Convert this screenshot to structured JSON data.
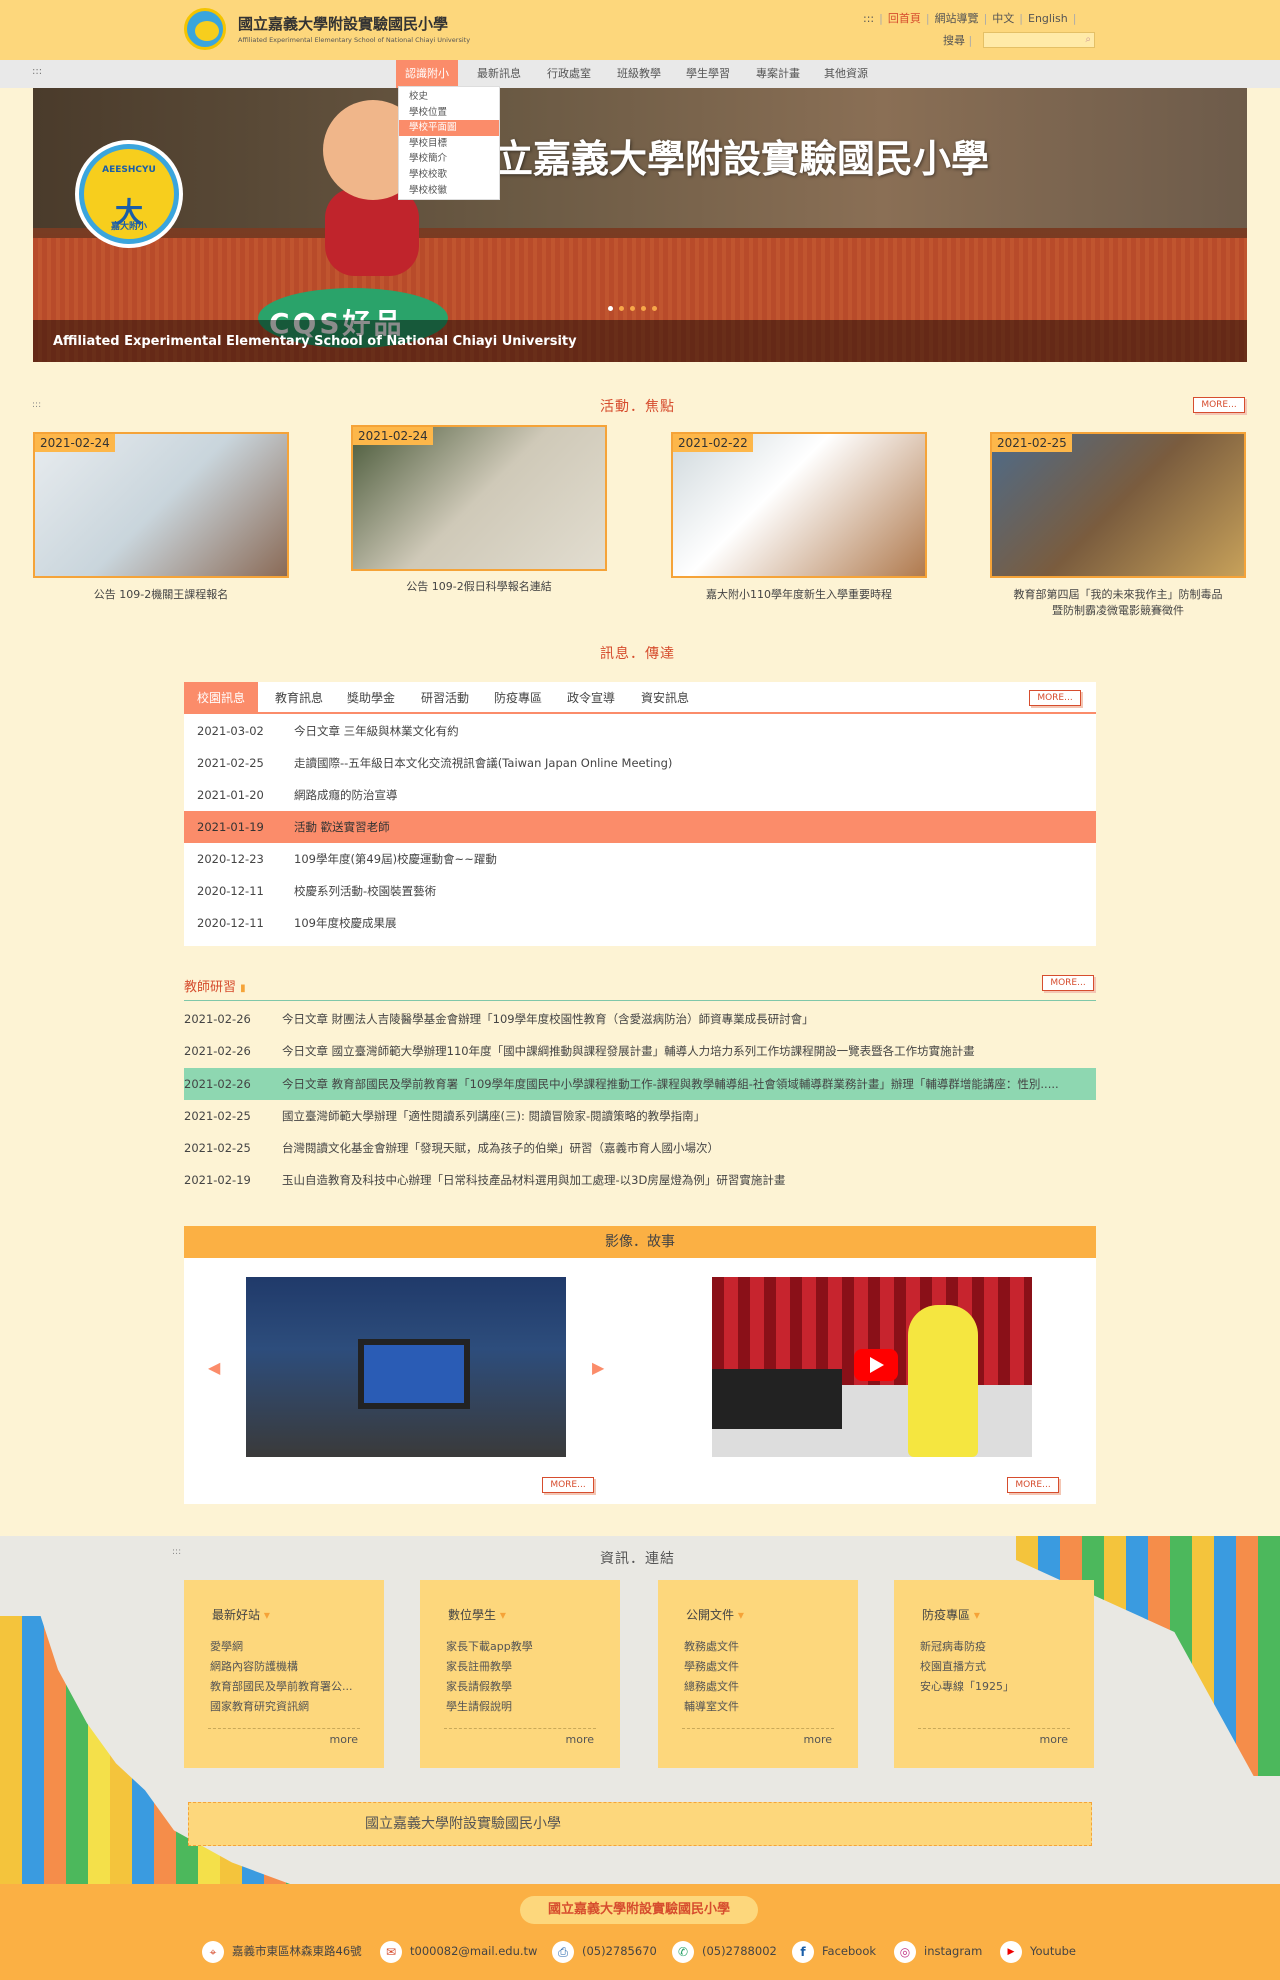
{
  "header": {
    "title": "國立嘉義大學附設實驗國民小學",
    "subtitle": "Affiliated Experimental Elementary School of National Chiayi University",
    "top_links": [
      ":::",
      "回首頁",
      "網站導覽",
      "中文",
      "English"
    ],
    "search_label": "搜尋"
  },
  "nav": {
    "dots": ":::",
    "items": [
      "認識附小",
      "最新訊息",
      "行政處室",
      "班級教學",
      "學生學習",
      "專案計畫",
      "其他資源"
    ],
    "dropdown": [
      "校史",
      "學校位置",
      "學校平面圖",
      "學校目標",
      "學校簡介",
      "學校校歌",
      "學校校徽"
    ]
  },
  "banner": {
    "title": "立嘉義大學附設實驗國民小學",
    "caption": "Affiliated Experimental Elementary School of National Chiayi University",
    "badge_top": "AEESHCYU",
    "badge_mid": "大",
    "badge_bot": "嘉大附小",
    "mascot_base": "CQS好品",
    "slide_active": 1,
    "slide_count": 5
  },
  "focus": {
    "title": "活動．焦點",
    "dots": ":::",
    "more": "MORE...",
    "items": [
      {
        "date": "2021-02-24",
        "caption": "公告 109-2機關王課程報名"
      },
      {
        "date": "2021-02-24",
        "caption": "公告 109-2假日科學報名連結"
      },
      {
        "date": "2021-02-22",
        "caption": "嘉大附小110學年度新生入學重要時程"
      },
      {
        "date": "2021-02-25",
        "caption": "教育部第四屆「我的未來我作主」防制毒品暨防制霸凌微電影競賽徵件"
      }
    ]
  },
  "news": {
    "title": "訊息．傳達",
    "more": "MORE...",
    "tabs": [
      "校園訊息",
      "教育訊息",
      "獎助學金",
      "研習活動",
      "防疫專區",
      "政令宣導",
      "資安訊息"
    ],
    "rows": [
      {
        "date": "2021-03-02",
        "text": "今日文章 三年級與林業文化有約"
      },
      {
        "date": "2021-02-25",
        "text": "走讀國際--五年級日本文化交流視訊會議(Taiwan Japan Online Meeting)"
      },
      {
        "date": "2021-01-20",
        "text": "網路成癮的防治宣導"
      },
      {
        "date": "2021-01-19",
        "text": "活動 歡送實習老師"
      },
      {
        "date": "2020-12-23",
        "text": "109學年度(第49屆)校慶運動會~~躍動"
      },
      {
        "date": "2020-12-11",
        "text": "校慶系列活動-校園裝置藝術"
      },
      {
        "date": "2020-12-11",
        "text": "109年度校慶成果展"
      }
    ]
  },
  "teacher": {
    "title": "教師研習",
    "more": "MORE...",
    "rows": [
      {
        "date": "2021-02-26",
        "text": "今日文章 財團法人吉陵醫學基金會辦理「109學年度校園性教育（含愛滋病防治）師資專業成長研討會」"
      },
      {
        "date": "2021-02-26",
        "text": "今日文章 國立臺灣師範大學辦理110年度「國中課綱推動與課程發展計畫」輔導人力培力系列工作坊課程開設一覽表暨各工作坊實施計畫"
      },
      {
        "date": "2021-02-26",
        "text": "今日文章 教育部國民及學前教育署「109學年度國民中小學課程推動工作-課程與教學輔導組-社會領域輔導群業務計畫」辦理「輔導群增能講座：性別....."
      },
      {
        "date": "2021-02-25",
        "text": "國立臺灣師範大學辦理「適性閱讀系列講座(三): 閱讀冒險家-閱讀策略的教學指南」"
      },
      {
        "date": "2021-02-25",
        "text": "台灣閱讀文化基金會辦理「發現天賦，成為孩子的伯樂」研習（嘉義市育人國小場次）"
      },
      {
        "date": "2021-02-19",
        "text": "玉山自造教育及科技中心辦理「日常科技產品材料選用與加工處理-以3D房屋燈為例」研習實施計畫"
      }
    ]
  },
  "video": {
    "title": "影像．故事",
    "more": "MORE...",
    "prev": "◀",
    "next": "▶"
  },
  "info": {
    "title": "資訊．連結",
    "dots": ":::",
    "cards": [
      {
        "title": "最新好站",
        "links": [
          "愛學網",
          "網路內容防護機構",
          "教育部國民及學前教育署公...",
          "國家教育研究資訊網"
        ],
        "more": "more"
      },
      {
        "title": "數位學生",
        "links": [
          "家長下載app教學",
          "家長註冊教學",
          "家長請假教學",
          "學生請假說明"
        ],
        "more": "more"
      },
      {
        "title": "公開文件",
        "links": [
          "教務處文件",
          "學務處文件",
          "總務處文件",
          "輔導室文件"
        ],
        "more": "more"
      },
      {
        "title": "防疫專區",
        "links": [
          "新冠病毒防疫",
          "校園直播方式",
          "安心專線「1925」"
        ],
        "more": "more"
      }
    ],
    "strip": "國立嘉義大學附設實驗國民小學"
  },
  "footer": {
    "name": "國立嘉義大學附設實驗國民小學",
    "items": [
      {
        "icon": "location-icon",
        "glyph": "⌖",
        "text": "嘉義市東區林森東路46號"
      },
      {
        "icon": "mail-icon",
        "glyph": "✉",
        "text": "t000082@mail.edu.tw"
      },
      {
        "icon": "fax-icon",
        "glyph": "⎙",
        "text": "(05)2785670"
      },
      {
        "icon": "phone-icon",
        "glyph": "✆",
        "text": "(05)2788002"
      },
      {
        "icon": "facebook-icon",
        "glyph": "f",
        "text": "Facebook"
      },
      {
        "icon": "instagram-icon",
        "glyph": "◎",
        "text": "instagram"
      },
      {
        "icon": "youtube-icon",
        "glyph": "▶",
        "text": "Youtube"
      }
    ]
  },
  "colors": {
    "accent": "#fb8c6a",
    "header": "#fdd77c",
    "green_highlight": "#8ed7b1",
    "footer": "#fbb044"
  }
}
